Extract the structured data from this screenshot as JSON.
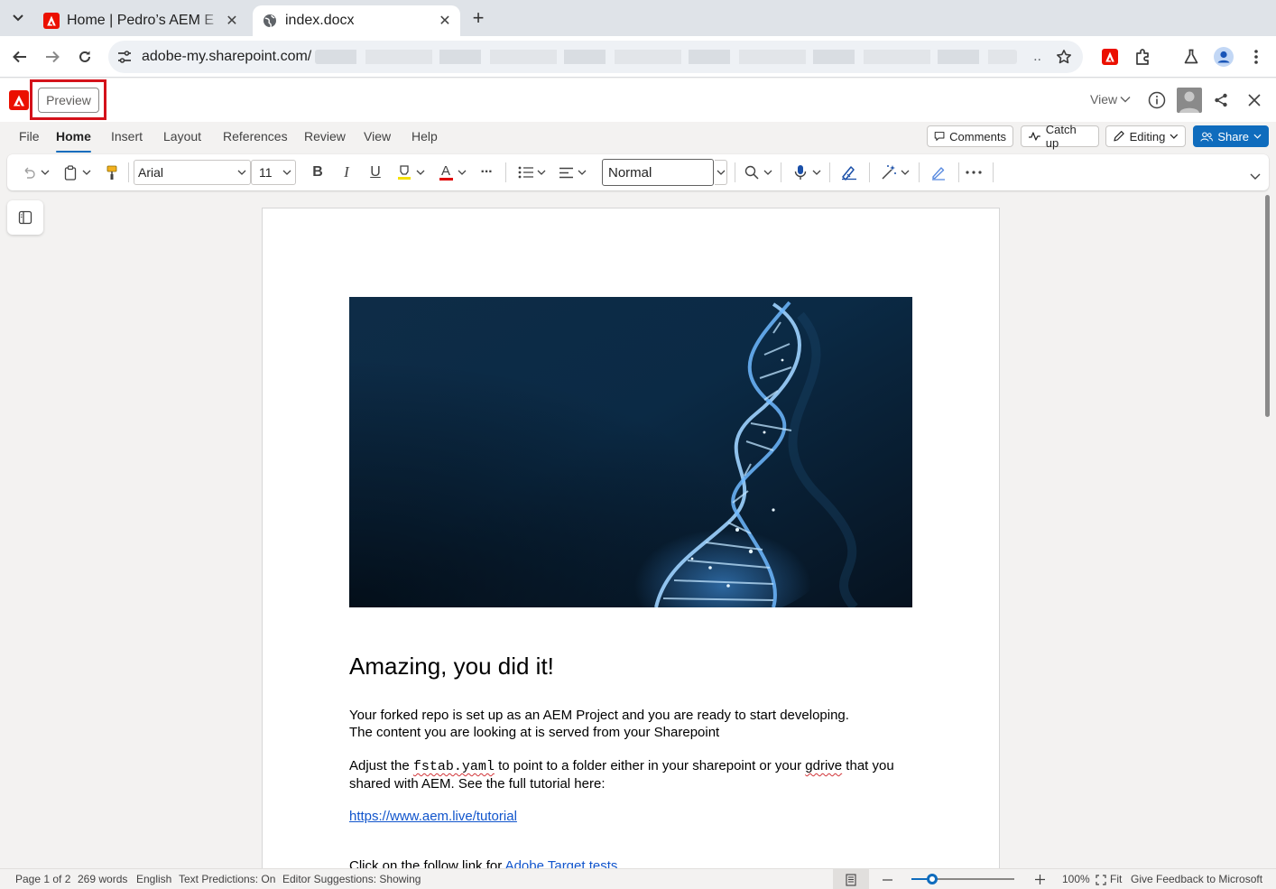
{
  "browser": {
    "tabs": [
      {
        "title": "Home | Pedro’s AEM E",
        "close": "✕",
        "active": false
      },
      {
        "title": "index.docx",
        "close": "✕",
        "active": true
      }
    ],
    "new_tab": "+",
    "url": "adobe-my.sharepoint.com/",
    "url_ellipsis": ".."
  },
  "app": {
    "preview_label": "Preview",
    "view_label": "View"
  },
  "ribbon": {
    "tabs": [
      "File",
      "Home",
      "Insert",
      "Layout",
      "References",
      "Review",
      "View",
      "Help"
    ],
    "active_tab": "Home",
    "comments": "Comments",
    "catch_up": "Catch up",
    "editing": "Editing",
    "share": "Share"
  },
  "toolbar": {
    "font": "Arial",
    "size": "11",
    "style": "Normal",
    "bold": "B",
    "italic": "I",
    "underline": "U",
    "font_color": "A",
    "more": "···"
  },
  "document": {
    "heading": "Amazing, you did it!",
    "para1_line1": "Your forked repo is set up as an AEM Project and you are ready to start developing.",
    "para1_line2": "The content you are looking at is served from your Sharepoint",
    "para2_before": "Adjust the ",
    "para2_code": "fstab.yaml",
    "para2_mid": " to point to a folder either in your sharepoint or your ",
    "para2_gdrive": "gdrive",
    "para2_after": " that you",
    "para2_line2": "shared with AEM. See the full tutorial here:",
    "tutorial_link": "https://www.aem.live/tutorial",
    "para3_before": "Click on the follow link for ",
    "para3_link": "Adobe Target tests"
  },
  "status": {
    "page": "Page 1 of 2",
    "words": "269 words",
    "language": "English",
    "text_predictions": "Text Predictions: On",
    "editor_suggestions": "Editor Suggestions: Showing",
    "zoom": "100%",
    "fit": "Fit",
    "feedback": "Give Feedback to Microsoft",
    "zoom_level": 0.2
  },
  "colors": {
    "accent": "#0f6cbd",
    "adobe_red": "#eb1000",
    "highlight_frame": "#d4121a"
  }
}
